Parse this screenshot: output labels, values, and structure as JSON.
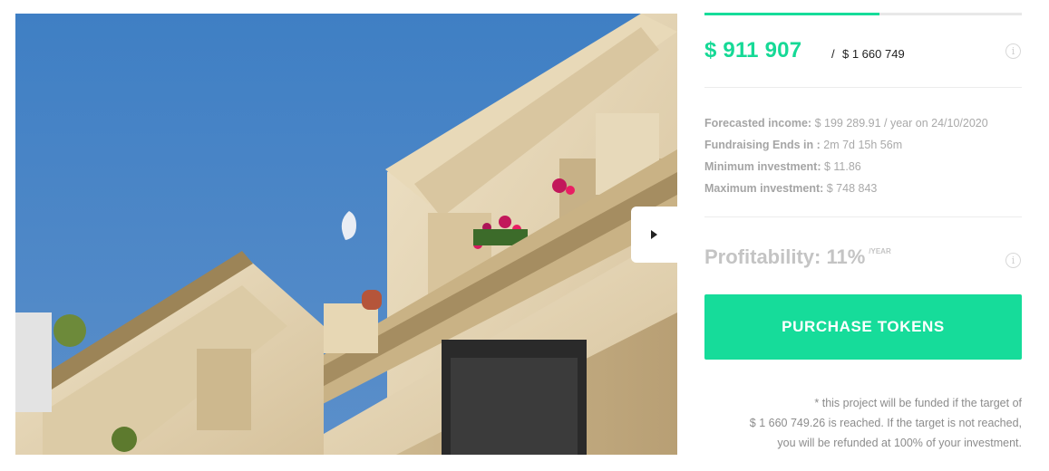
{
  "project": {
    "progress_percent": 55,
    "raised_amount": "$ 911 907",
    "target_separator": "/",
    "target_amount": "$ 1 660 749",
    "info_glyph": "i"
  },
  "stats": [
    {
      "label": "Forecasted income:",
      "value": " $ 199 289.91 / year on 24/10/2020"
    },
    {
      "label": "Fundraising Ends in :",
      "value": " 2m 7d 15h 56m"
    },
    {
      "label": "Minimum investment:",
      "value": " $ 11.86"
    },
    {
      "label": "Maximum investment:",
      "value": " $ 748 843"
    }
  ],
  "profitability": {
    "label": "Profitability: 11%",
    "unit": "/YEAR"
  },
  "purchase_button": "PURCHASE TOKENS",
  "funding_note": {
    "line1": "* this project will be funded if the target of",
    "line2": "$ 1 660 749.26 is reached. If the target is not reached,",
    "line3": "you will be refunded at 100% of your investment."
  },
  "gallery": {
    "next_icon": "play-triangle-icon"
  },
  "colors": {
    "accent": "#16dc9a",
    "sky": "#4a83c1",
    "muted_text": "#a9a9a9"
  }
}
